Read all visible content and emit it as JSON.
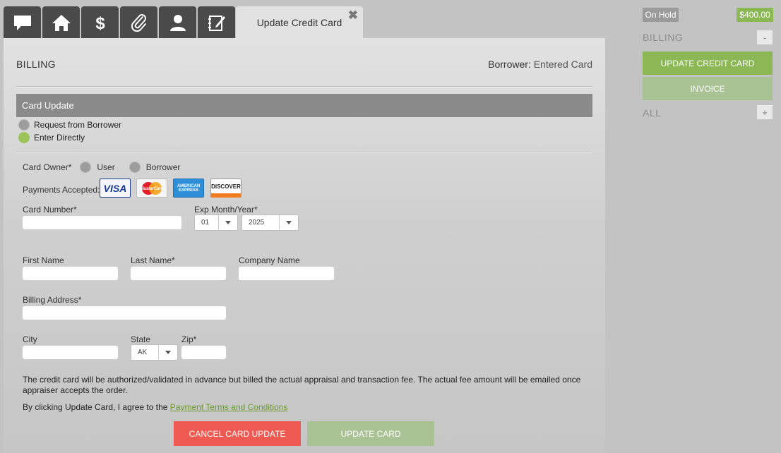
{
  "tabs": {
    "icons": [
      "chat-icon",
      "home-icon",
      "dollar-icon",
      "paperclip-icon",
      "user-icon",
      "notebook-icon"
    ],
    "active_label": "Update Credit Card",
    "close_symbol": "✖"
  },
  "panel": {
    "title": "BILLING",
    "borrower_label": "Borrower:",
    "borrower_value": "Entered Card",
    "section_title": "Card Update",
    "options": [
      "Request from Borrower",
      "Enter Directly"
    ],
    "selected_option": "Enter Directly",
    "card_owner_label": "Card Owner*",
    "card_owner_options": [
      "User",
      "Borrower"
    ],
    "payments_label": "Payments Accepted:",
    "card_brands": [
      "VISA",
      "MasterCard",
      "AMERICAN EXPRESS",
      "DISCOVER"
    ],
    "card_number_label": "Card Number*",
    "exp_label": "Exp Month/Year*",
    "exp_month": "01",
    "exp_year": "2025",
    "first_name_label": "First Name",
    "last_name_label": "Last Name*",
    "company_label": "Company Name",
    "address_label": "Billing Address*",
    "city_label": "City",
    "state_label": "State",
    "state_value": "AK",
    "zip_label": "Zip*",
    "disclaimer": "The credit card will be authorized/validated in advance but billed the actual appraisal and transaction fee. The actual fee amount will be emailed once appraiser accepts the order.",
    "agree_text": "By clicking Update Card, I agree to the",
    "terms_link": "Payment Terms and Conditions",
    "cancel_button": "CANCEL CARD UPDATE",
    "update_button": "UPDATE CARD"
  },
  "sidebar": {
    "status_badge": "On Hold",
    "amount_badge": "$400.00",
    "billing_label": "BILLING",
    "billing_toggle": "-",
    "update_cc_button": "UPDATE CREDIT CARD",
    "invoice_button": "INVOICE",
    "all_label": "ALL",
    "all_toggle": "+"
  },
  "colors": {
    "accent_green": "#8bb755",
    "disabled_green": "#a9c293",
    "cancel_red": "#ee5a52",
    "tab_dark": "#4a4a4a",
    "header_gray": "#8a8a8a"
  }
}
